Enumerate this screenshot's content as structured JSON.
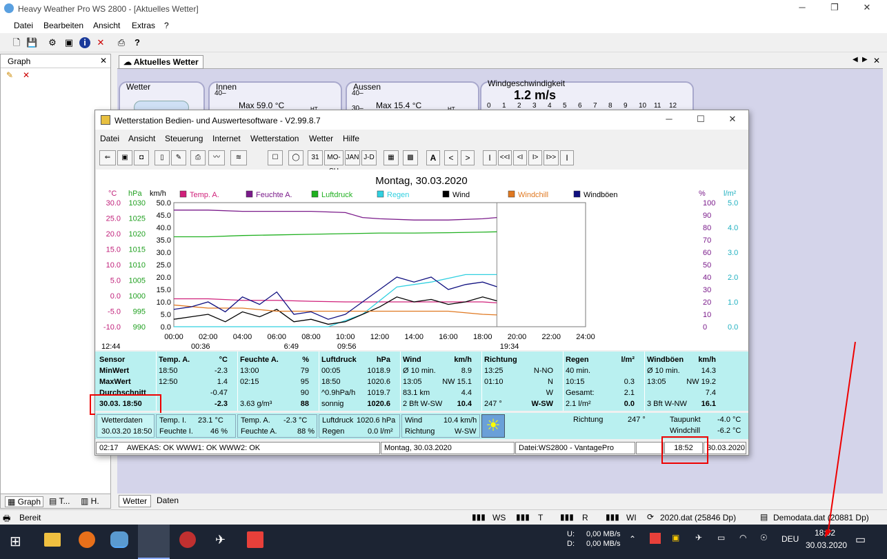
{
  "main_window": {
    "title": "Heavy Weather Pro WS 2800 - [Aktuelles Wetter]",
    "menu": [
      "Datei",
      "Bearbeiten",
      "Ansicht",
      "Extras",
      "?"
    ]
  },
  "left_panel": {
    "title": "Graph",
    "tabs": [
      "Graph",
      "T...",
      "H."
    ]
  },
  "tab_title": "Aktuelles Wetter",
  "groups": {
    "wetter": "Wetter",
    "innen": "Innen",
    "innen_max": "Max 59.0 °C",
    "aussen": "Aussen",
    "aussen_max": "Max 15.4 °C",
    "wind_title": "Windgeschwindigkeit",
    "wind_value": "1.2 m/s",
    "wind_scale": [
      "0",
      "1",
      "2",
      "3",
      "4",
      "5",
      "6",
      "7",
      "8",
      "9",
      "10",
      "11",
      "12"
    ],
    "axis_40": "40–",
    "axis_30": "30–",
    "ht": "HT"
  },
  "bottom_tabs": [
    "Wetter",
    "Daten"
  ],
  "statusbar": {
    "text": "Bereit",
    "ws": "WS",
    "t": "T",
    "r": "R",
    "wi": "WI",
    "file1": "2020.dat (25846 Dp)",
    "file2": "Demodata.dat (20881 Dp)"
  },
  "dialog": {
    "title": "Wetterstation Bedien- und Auswertesoftware - V2.99.8.7",
    "menu": [
      "Datei",
      "Ansicht",
      "Steuerung",
      "Internet",
      "Wetterstation",
      "Wetter",
      "Hilfe"
    ],
    "nav": [
      "A",
      "<",
      ">",
      "I",
      "<<I",
      "<I",
      "I>",
      "I>>",
      "I"
    ],
    "date_title": "Montag, 30.03.2020"
  },
  "chart_data": {
    "type": "line",
    "title": "Montag, 30.03.2020",
    "units": {
      "c": "°C",
      "hpa": "hPa",
      "kmh": "km/h",
      "pct": "%",
      "lm2": "l/m²"
    },
    "axis_c": [
      "30.0",
      "25.0",
      "20.0",
      "15.0",
      "10.0",
      "5.0",
      "0.0",
      "-5.0",
      "-10.0"
    ],
    "axis_hpa": [
      "1030",
      "1025",
      "1020",
      "1015",
      "1010",
      "1005",
      "1000",
      "995",
      "990"
    ],
    "axis_kmh": [
      "50.0",
      "45.0",
      "40.0",
      "35.0",
      "30.0",
      "25.0",
      "20.0",
      "15.0",
      "10.0",
      "5.0",
      "0.0"
    ],
    "axis_pct": [
      "100",
      "90",
      "80",
      "70",
      "60",
      "50",
      "40",
      "30",
      "20",
      "10",
      "0"
    ],
    "axis_lm2": [
      "5.0",
      "4.0",
      "3.0",
      "2.0",
      "1.0",
      "0.0"
    ],
    "x_ticks": [
      "00:00",
      "02:00",
      "04:00",
      "06:00",
      "08:00",
      "10:00",
      "12:00",
      "14:00",
      "16:00",
      "18:00",
      "20:00",
      "22:00",
      "24:00"
    ],
    "xlim": [
      0,
      24
    ],
    "series": [
      {
        "name": "Temp. A.",
        "color": "#d0207a",
        "x": [
          0,
          2,
          4,
          6,
          8,
          10,
          12,
          14,
          16,
          18,
          18.83
        ],
        "y": [
          -1,
          -1,
          -1.5,
          -1.5,
          -1.8,
          -2,
          -2,
          -2,
          -2,
          -2,
          -2.3
        ]
      },
      {
        "name": "Feuchte A.",
        "color": "#7a1a8a",
        "x": [
          0,
          2,
          4,
          6,
          8,
          10,
          11,
          12,
          14,
          16,
          18,
          18.83
        ],
        "y": [
          94,
          94,
          93,
          93,
          93,
          92,
          88,
          87,
          86,
          86,
          87,
          88
        ]
      },
      {
        "name": "Luftdruck",
        "color": "#20b020",
        "x": [
          0,
          2,
          4,
          6,
          8,
          10,
          12,
          14,
          16,
          18,
          18.83
        ],
        "y": [
          1019,
          1019,
          1019.4,
          1019.6,
          1019.8,
          1020,
          1020.2,
          1020.2,
          1020.3,
          1020.5,
          1020.6
        ]
      },
      {
        "name": "Regen",
        "color": "#30d0e0",
        "x": [
          0,
          9,
          11,
          13,
          15,
          17,
          18.83
        ],
        "y": [
          0,
          0,
          0.5,
          1.6,
          1.8,
          2.1,
          2.1
        ]
      },
      {
        "name": "Wind",
        "color": "#000000",
        "x": [
          0,
          1,
          2,
          3,
          4,
          5,
          6,
          7,
          8,
          9,
          10,
          11,
          12,
          13,
          14,
          15,
          16,
          17,
          18,
          18.83
        ],
        "y": [
          3,
          4,
          5,
          2,
          6,
          4,
          7,
          2,
          3,
          1,
          2,
          5,
          8,
          12,
          10,
          11,
          9,
          10,
          12,
          10.4
        ]
      },
      {
        "name": "Windchill",
        "color": "#e07820",
        "x": [
          0,
          2,
          4,
          6,
          8,
          10,
          12,
          14,
          16,
          18,
          18.83
        ],
        "y": [
          -3,
          -4,
          -4,
          -5,
          -5,
          -5,
          -5,
          -5,
          -5,
          -6,
          -6.2
        ]
      },
      {
        "name": "Windböen",
        "color": "#101080",
        "x": [
          0,
          1,
          2,
          3,
          4,
          5,
          6,
          7,
          8,
          9,
          10,
          11,
          12,
          13,
          14,
          15,
          16,
          17,
          18,
          18.83
        ],
        "y": [
          7,
          8,
          10,
          6,
          12,
          9,
          14,
          5,
          6,
          3,
          5,
          10,
          15,
          20,
          18,
          20,
          15,
          17,
          18,
          16.1
        ]
      }
    ],
    "sun": {
      "rise": "6:49",
      "set": "19:34",
      "moon_rise": "12:44",
      "moon1": "00:36",
      "moon2": "09:56",
      "now": "19:34"
    }
  },
  "table": {
    "headers": [
      [
        "Sensor",
        ""
      ],
      [
        "Temp. A.",
        "°C"
      ],
      [
        "Feuchte A.",
        "%"
      ],
      [
        "Luftdruck",
        "hPa"
      ],
      [
        "Wind",
        "km/h"
      ],
      [
        "Richtung",
        ""
      ],
      [
        "Regen",
        "l/m²"
      ],
      [
        "Windböen",
        "km/h"
      ]
    ],
    "labels": [
      "MinWert",
      "MaxWert",
      "Durchschnitt",
      "30.03. 18:50"
    ],
    "temp": [
      [
        "18:50",
        "-2.3"
      ],
      [
        "12:50",
        "1.4"
      ],
      [
        "",
        "-0.47"
      ],
      [
        "",
        "-2.3"
      ]
    ],
    "feuchte": [
      [
        "13:00",
        "79"
      ],
      [
        "02:15",
        "95"
      ],
      [
        "",
        "90"
      ],
      [
        "3.63 g/m³",
        "88"
      ]
    ],
    "luft": [
      [
        "00:05",
        "1018.9"
      ],
      [
        "18:50",
        "1020.6"
      ],
      [
        "^0.9hPa/h",
        "1019.7"
      ],
      [
        "sonnig",
        "1020.6"
      ]
    ],
    "wind": [
      [
        "Ø 10 min.",
        "8.9"
      ],
      [
        "13:05",
        "NW 15.1"
      ],
      [
        "83.1 km",
        "4.4"
      ],
      [
        "2 Bft W-SW",
        "10.4"
      ]
    ],
    "richtung": [
      [
        "13:25",
        "N-NO"
      ],
      [
        "01:10",
        "N"
      ],
      [
        "",
        "W"
      ],
      [
        "247 °",
        "W-SW"
      ]
    ],
    "regen": [
      [
        "40 min.",
        ""
      ],
      [
        "10:15",
        "0.3"
      ],
      [
        "Gesamt:",
        "2.1"
      ],
      [
        "2.1 l/m²",
        "0.0"
      ]
    ],
    "boeen": [
      [
        "Ø 10 min.",
        "14.3"
      ],
      [
        "13:05",
        "NW 19.2"
      ],
      [
        "",
        "7.4"
      ],
      [
        "3 Bft W-NW",
        "16.1"
      ]
    ]
  },
  "row2": {
    "wetterdaten": "Wetterdaten",
    "wd_time": "30.03.20 18:50",
    "temp_i": "Temp. I.",
    "temp_i_v": "23.1 °C",
    "feuchte_i": "Feuchte I.",
    "feuchte_i_v": "46 %",
    "temp_a": "Temp. A.",
    "temp_a_v": "-2.3 °C",
    "feuchte_a": "Feuchte A.",
    "feuchte_a_v": "88 %",
    "luftdruck": "Luftdruck",
    "luftdruck_v": "1020.6 hPa",
    "regen": "Regen",
    "regen_v": "0.0 l/m²",
    "wind": "Wind",
    "wind_v": "10.4 km/h",
    "richtung": "Richtung",
    "richtung_v": "W-SW",
    "richtung2": "Richtung",
    "richtung2_v": "247 °",
    "taupunkt": "Taupunkt",
    "taupunkt_v": "-4.0 °C",
    "windchill": "Windchill",
    "windchill_v": "-6.2 °C"
  },
  "status": {
    "time": "02:17",
    "awekas": "AWEKAS: OK WWW1: OK WWW2: OK",
    "date": "Montag, 30.03.2020",
    "file": "Datei:WS2800 - VantagePro",
    "clock": "18:52",
    "date2": "30.03.2020"
  },
  "taskbar": {
    "net_u": "U:",
    "net_d": "D:",
    "net_u_v": "0,00 MB/s",
    "net_d_v": "0,00 MB/s",
    "lang": "DEU",
    "time": "18:52",
    "date": "30.03.2020"
  }
}
